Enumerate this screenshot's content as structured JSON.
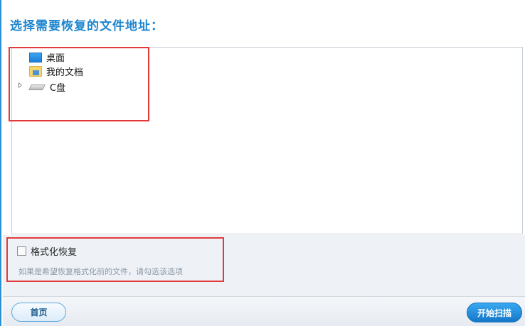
{
  "title": "选择需要恢复的文件地址：",
  "tree": {
    "items": [
      {
        "label": "桌面",
        "icon": "desktop-icon",
        "expandable": false
      },
      {
        "label": "我的文档",
        "icon": "documents-folder-icon",
        "expandable": false
      },
      {
        "label": "C盘",
        "icon": "drive-icon",
        "expandable": true
      }
    ]
  },
  "format_recovery": {
    "label": "格式化恢复",
    "checked": false,
    "hint": "如果是希望恢复格式化前的文件，请勾选该选项"
  },
  "footer": {
    "home_label": "首页",
    "scan_label": "开始扫描"
  },
  "colors": {
    "accent": "#1f86cf",
    "highlight_border": "#e23a3a",
    "scan_button": "#1577c9"
  }
}
